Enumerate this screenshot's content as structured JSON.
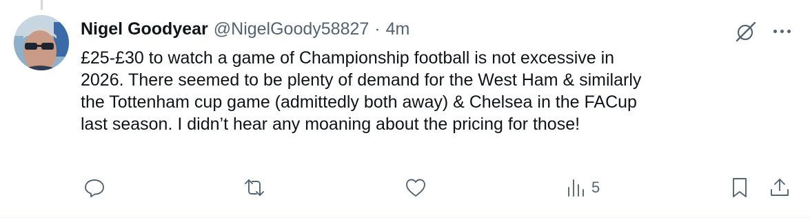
{
  "post": {
    "author_name": "Nigel Goodyear",
    "handle": "@NigelGoody58827",
    "separator": "·",
    "time": "4m",
    "text_lines": [
      "£25-£30 to watch a game of Championship football is not excessive in",
      "2026. There seemed to be plenty of demand for the West Ham & similarly",
      "the Tottenham cup game (admittedly both away) & Chelsea in the FACup",
      "last season. I didn’t hear any moaning about the pricing for those!"
    ]
  },
  "actions": {
    "views_count": "5"
  },
  "icons": {
    "reply": "speech-bubble-icon",
    "repost": "repost-arrows-icon",
    "like": "heart-icon",
    "views": "bar-chart-icon",
    "bookmark": "bookmark-icon",
    "share": "upload-share-icon",
    "grok": "grok-slash-circle-icon",
    "more": "three-dots-icon"
  },
  "colors": {
    "text_primary": "#0f1419",
    "text_secondary": "#536471",
    "thread_line": "#cfd9de"
  }
}
